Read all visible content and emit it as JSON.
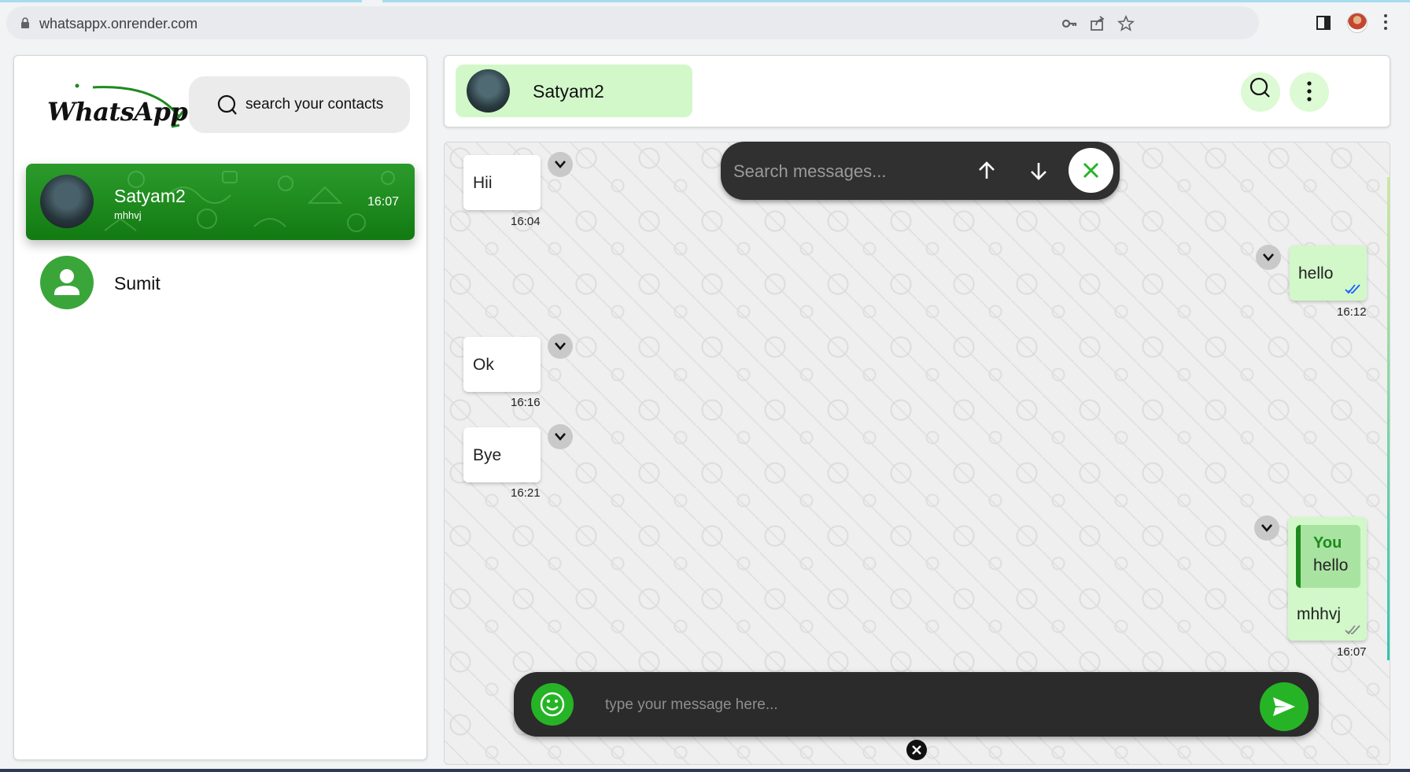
{
  "browser": {
    "url": "whatsappx.onrender.com"
  },
  "sidebar": {
    "logo_text": "WhatsApp",
    "search_label": "search your contacts",
    "contacts": [
      {
        "name": "Satyam2",
        "last_message": "mhhvj",
        "time": "16:07",
        "active": true
      },
      {
        "name": "Sumit",
        "last_message": "",
        "time": "",
        "active": false
      }
    ]
  },
  "chat": {
    "contact_name": "Satyam2",
    "search_placeholder": "Search messages...",
    "composer_placeholder": "type your message here...",
    "messages": [
      {
        "direction": "in",
        "text": "Hii",
        "time": "16:04"
      },
      {
        "direction": "out",
        "text": "hello",
        "time": "16:12",
        "read": true
      },
      {
        "direction": "in",
        "text": "Ok",
        "time": "16:16"
      },
      {
        "direction": "in",
        "text": "Bye",
        "time": "16:21"
      },
      {
        "direction": "out",
        "reply_to": {
          "author": "You",
          "text": "hello"
        },
        "text": "mhhvj",
        "time": "16:07",
        "read": false
      }
    ]
  },
  "colors": {
    "accent_green": "#26b426",
    "dark_green": "#1e8a1e",
    "light_green": "#d2f8c9",
    "bar_dark": "#2b2b2b",
    "read_tick": "#1a5cff"
  },
  "icons": [
    "lock-icon",
    "key-icon",
    "share-icon",
    "star-icon",
    "sidebar-toggle-icon",
    "kebab-icon",
    "search-icon",
    "up-arrow-icon",
    "down-arrow-icon",
    "close-icon",
    "chevron-down-icon",
    "emoji-icon",
    "send-icon",
    "person-icon",
    "double-check-icon"
  ]
}
